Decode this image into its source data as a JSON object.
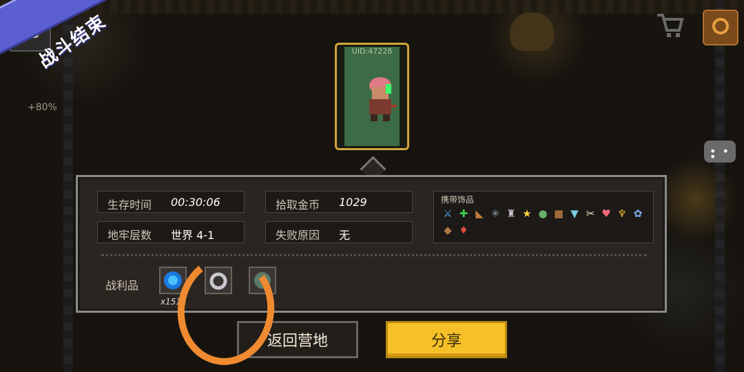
{
  "banner": {
    "title": "战斗结束"
  },
  "player": {
    "bonus_text": "+80%"
  },
  "character_card": {
    "uid": "UID:47228"
  },
  "stats": {
    "survival_time_label": "生存时间",
    "survival_time_value": "00:30:06",
    "gold_label": "拾取金币",
    "gold_value": "1029",
    "dungeon_level_label": "地牢层数",
    "dungeon_level_value": "世界 4-1",
    "fail_reason_label": "失败原因",
    "fail_reason_value": "无"
  },
  "accessories": {
    "title": "携带饰品",
    "icons": [
      "dagger-icon",
      "clover-icon",
      "horn-icon",
      "spider-icon",
      "helmet-icon",
      "star-icon",
      "potion-icon",
      "book-icon",
      "sock-icon",
      "bone-icon",
      "heart-icon",
      "wings-icon",
      "glove-icon",
      "plank-icon",
      "bottle-icon"
    ]
  },
  "loot": {
    "title": "战利品",
    "items": [
      {
        "icon": "blue-gem-icon",
        "count": "x1515"
      },
      {
        "icon": "ring-icon"
      },
      {
        "icon": "stone-icon"
      }
    ]
  },
  "buttons": {
    "return_camp": "返回营地",
    "share": "分享"
  },
  "colors": {
    "ribbon": "#5b5fd0",
    "share_button": "#f5c028",
    "annotation": "#f08a30"
  }
}
